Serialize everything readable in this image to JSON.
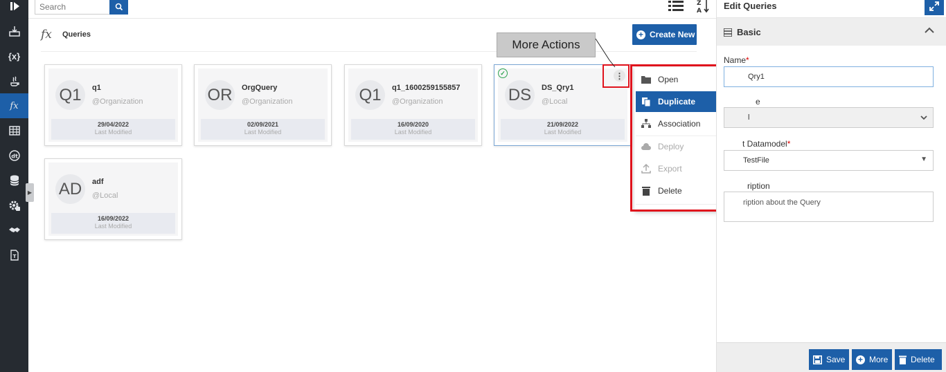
{
  "topbar": {
    "search_placeholder": "Search"
  },
  "header": {
    "icon_text": "fx",
    "title": "Queries",
    "create_label": "Create New"
  },
  "cards": [
    {
      "initials": "Q1",
      "name": "q1",
      "scope": "@Organization",
      "date": "29/04/2022",
      "modified_label": "Last Modified"
    },
    {
      "initials": "OR",
      "name": "OrgQuery",
      "scope": "@Organization",
      "date": "02/09/2021",
      "modified_label": "Last Modified"
    },
    {
      "initials": "Q1",
      "name": "q1_1600259155857",
      "scope": "@Organization",
      "date": "16/09/2020",
      "modified_label": "Last Modified"
    },
    {
      "initials": "DS",
      "name": "DS_Qry1",
      "scope": "@Local",
      "date": "21/09/2022",
      "modified_label": "Last Modified",
      "selected": true
    },
    {
      "initials": "AD",
      "name": "adf",
      "scope": "@Local",
      "date": "16/09/2022",
      "modified_label": "Last Modified"
    }
  ],
  "menu": {
    "items": [
      {
        "label": "Open",
        "icon": "folder-icon",
        "state": "normal"
      },
      {
        "label": "Duplicate",
        "icon": "copy-icon",
        "state": "active"
      },
      {
        "label": "Association",
        "icon": "sitemap-icon",
        "state": "normal"
      },
      {
        "label": "Deploy",
        "icon": "cloud-upload-icon",
        "state": "disabled"
      },
      {
        "label": "Export",
        "icon": "upload-icon",
        "state": "disabled"
      },
      {
        "label": "Delete",
        "icon": "trash-icon",
        "state": "normal"
      }
    ]
  },
  "callout": {
    "text": "More Actions"
  },
  "panel": {
    "title": "Edit Queries",
    "section": "Basic",
    "name_label": "Name",
    "name_value": "Qry1",
    "type_label": "e",
    "type_value": "l",
    "datamodel_label": "t Datamodel",
    "datamodel_value": "TestFile",
    "description_label": "ription",
    "description_placeholder": "ription about the Query",
    "buttons": {
      "save": "Save",
      "more": "More",
      "delete": "Delete"
    }
  },
  "colors": {
    "accent": "#1d5fa8",
    "sidebar": "#262b31",
    "highlight": "#e0121c"
  }
}
